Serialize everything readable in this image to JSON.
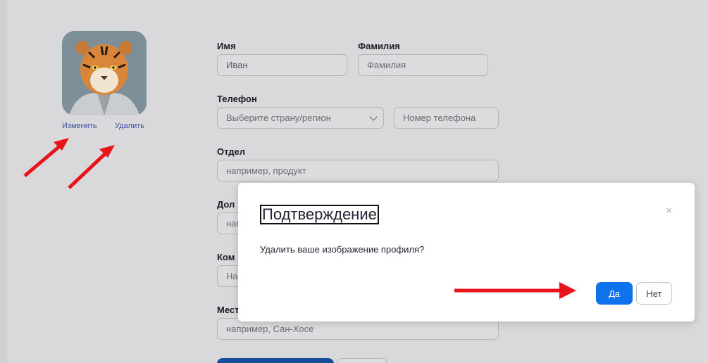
{
  "profile": {
    "change_link": "Изменить",
    "delete_link": "Удалить"
  },
  "form": {
    "first_name_label": "Имя",
    "first_name_value": "Иван",
    "last_name_label": "Фамилия",
    "last_name_placeholder": "Фамилия",
    "phone_label": "Телефон",
    "country_select": "Выберите страну/регион",
    "phone_placeholder": "Номер телефона",
    "department_label": "Отдел",
    "department_placeholder": "например, продукт",
    "position_label_partial": "Дол",
    "position_placeholder_partial": "нап",
    "company_label_partial": "Ком",
    "company_placeholder_partial": "На",
    "location_label_partial": "Мест",
    "location_placeholder": "например, Сан-Хосе"
  },
  "modal": {
    "title": "Подтверждение",
    "close_icon": "×",
    "message": "Удалить ваше изображение профиля?",
    "yes_label": "Да",
    "no_label": "Нет"
  },
  "colors": {
    "primary": "#0e72ed",
    "arrow": "#e8141a"
  }
}
